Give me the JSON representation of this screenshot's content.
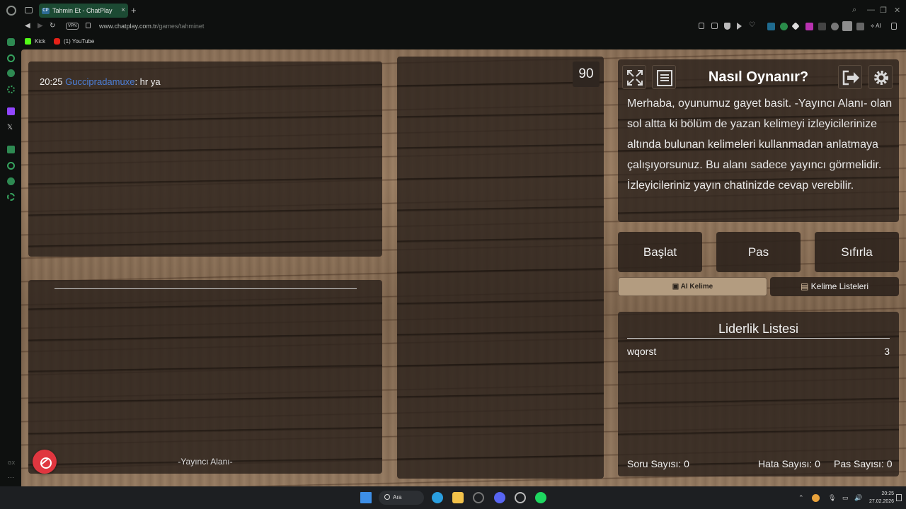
{
  "browser": {
    "tab_title": "Tahmin Et - ChatPlay",
    "tab_favicon": "CP",
    "new_tab": "+",
    "url_host": "www.chatplay.com.tr",
    "url_path": "/games/tahminet",
    "vpn_label": "VPN",
    "ai_label": "AI",
    "bookmarks": [
      "Kick",
      "(1) YouTube"
    ],
    "sidebar_label": "GX",
    "sidebar_more": "···"
  },
  "chat": {
    "time": "20:25",
    "user": "Guccipradamuxe",
    "message": ": hr ya"
  },
  "streamer_area": {
    "label": "-Yayıncı Alanı-"
  },
  "timer": {
    "value": "90"
  },
  "help": {
    "title": "Nasıl Oynanır?",
    "text": "Merhaba, oyunumuz gayet basit. -Yayıncı Alanı- olan sol altta ki bölüm de yazan kelimeyi izleyicilerinize altında bulunan kelimeleri kullanmadan anlatmaya çalışıyorsunuz. Bu alanı sadece yayıncı görmelidir. İzleyicileriniz yayın chatinizde cevap verebilir."
  },
  "controls": {
    "start": "Başlat",
    "pass": "Pas",
    "reset": "Sıfırla",
    "ai_word": "AI Kelime",
    "word_lists": "Kelime Listeleri"
  },
  "leaderboard": {
    "title": "Liderlik Listesi",
    "rows": [
      {
        "name": "wqorst",
        "score": "3"
      }
    ],
    "stats": {
      "questions_label": "Soru Sayısı:",
      "questions": "0",
      "errors_label": "Hata Sayısı:",
      "errors": "0",
      "passes_label": "Pas Sayısı:",
      "passes": "0"
    }
  },
  "taskbar": {
    "search": "Ara",
    "time": "20:25",
    "date": "27.02.2026"
  },
  "colors": {
    "chat_user": "#4c7fd8",
    "mute_button": "#e0363f",
    "ai_button": "#b39c80",
    "tab_active": "#1c4a33"
  }
}
